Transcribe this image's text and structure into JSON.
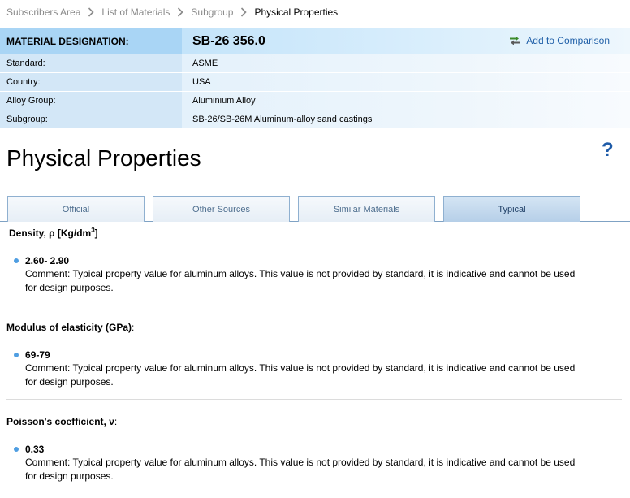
{
  "breadcrumb": {
    "items": [
      "Subscribers Area",
      "List of Materials",
      "Subgroup"
    ],
    "current": "Physical Properties"
  },
  "designation": {
    "label": "MATERIAL DESIGNATION:",
    "value": "SB-26 356.0",
    "compare_label": "Add to Comparison",
    "rows": [
      {
        "label": "Standard:",
        "value": "ASME"
      },
      {
        "label": "Country:",
        "value": "USA"
      },
      {
        "label": "Alloy Group:",
        "value": "Aluminium Alloy"
      },
      {
        "label": "Subgroup:",
        "value": "SB-26/SB-26M Aluminum-alloy sand castings"
      }
    ]
  },
  "page_title": "Physical Properties",
  "help_glyph": "?",
  "tabs": [
    {
      "label": "Official",
      "active": false
    },
    {
      "label": "Other Sources",
      "active": false
    },
    {
      "label": "Similar Materials",
      "active": false
    },
    {
      "label": "Typical",
      "active": true
    }
  ],
  "properties": [
    {
      "title_pre": "Density, ρ [Kg/dm",
      "title_sup": "3",
      "title_post": "]",
      "colon": "",
      "value": "2.60- 2.90",
      "comment_line1": "Comment: Typical property value for aluminum alloys. This value is not provided by standard, it is indicative and cannot be used",
      "comment_line2": "for design purposes."
    },
    {
      "title_pre": "Modulus of elasticity (GPa)",
      "colon": ":",
      "value": "69-79",
      "comment_line1": "Comment: Typical property value for aluminum alloys. This value is not provided by standard, it is indicative and cannot be used",
      "comment_line2": "for design purposes."
    },
    {
      "title_pre": "Poisson's coefficient, ν",
      "colon": ":",
      "value": "0.33",
      "comment_line1": "Comment: Typical property value for aluminum alloys. This value is not provided by standard, it is indicative and cannot be used",
      "comment_line2": "for design purposes."
    }
  ],
  "colors": {
    "accent": "#1f5fa8",
    "header_label_bg": "#a9d5f5",
    "row_label_bg": "#d3e7f7",
    "bullet": "#4f9ee2"
  }
}
